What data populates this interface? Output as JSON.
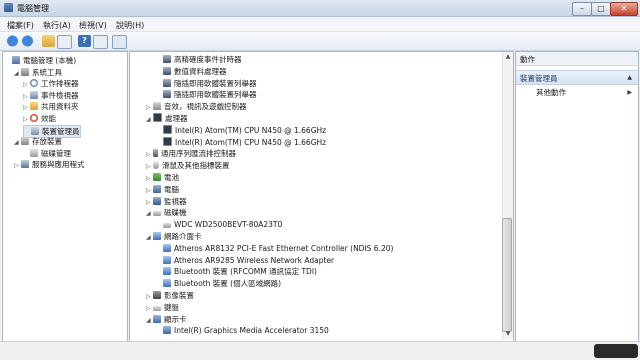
{
  "window": {
    "title": "電腦管理"
  },
  "menu": [
    "檔案(F)",
    "執行(A)",
    "檢視(V)",
    "說明(H)"
  ],
  "left_tree": [
    {
      "label": "電腦管理 (本機)",
      "indent": 0,
      "tri": "",
      "icon": "ico-comp"
    },
    {
      "label": "系統工具",
      "indent": 1,
      "tri": "◢",
      "icon": "ico-tool"
    },
    {
      "label": "工作排程器",
      "indent": 2,
      "tri": "▷",
      "icon": "ico-clock"
    },
    {
      "label": "事件檢視器",
      "indent": 2,
      "tri": "▷",
      "icon": "ico-event"
    },
    {
      "label": "共用資料夾",
      "indent": 2,
      "tri": "▷",
      "icon": "ico-folder"
    },
    {
      "label": "效能",
      "indent": 2,
      "tri": "▷",
      "icon": "ico-perf"
    },
    {
      "label": "裝置管理員",
      "indent": 2,
      "tri": "",
      "icon": "ico-dev",
      "selected": true
    },
    {
      "label": "存放裝置",
      "indent": 1,
      "tri": "◢",
      "icon": "ico-store"
    },
    {
      "label": "磁碟管理",
      "indent": 2,
      "tri": "",
      "icon": "ico-disk"
    },
    {
      "label": "服務與應用程式",
      "indent": 1,
      "tri": "▷",
      "icon": "ico-svc"
    }
  ],
  "device_tree": [
    {
      "label": "高精確度事件計時器",
      "indent": 2,
      "tri": "",
      "icon": "ico-chip"
    },
    {
      "label": "數值資料處理器",
      "indent": 2,
      "tri": "",
      "icon": "ico-chip"
    },
    {
      "label": "隨插即用軟體裝置列舉器",
      "indent": 2,
      "tri": "",
      "icon": "ico-chip"
    },
    {
      "label": "隨插即用軟體裝置列舉器",
      "indent": 2,
      "tri": "",
      "icon": "ico-chip"
    },
    {
      "label": "音效，視訊及遊戲控制器",
      "indent": 1,
      "tri": "▷",
      "icon": "ico-audio"
    },
    {
      "label": "處理器",
      "indent": 1,
      "tri": "◢",
      "icon": "ico-cpu"
    },
    {
      "label": "Intel(R) Atom(TM) CPU N450   @ 1.66GHz",
      "indent": 2,
      "tri": "",
      "icon": "ico-cpu"
    },
    {
      "label": "Intel(R) Atom(TM) CPU N450   @ 1.66GHz",
      "indent": 2,
      "tri": "",
      "icon": "ico-cpu"
    },
    {
      "label": "通用序列匯流排控制器",
      "indent": 1,
      "tri": "▷",
      "icon": "ico-usb"
    },
    {
      "label": "滑鼠及其他指標裝置",
      "indent": 1,
      "tri": "▷",
      "icon": "ico-mouse"
    },
    {
      "label": "電池",
      "indent": 1,
      "tri": "▷",
      "icon": "ico-battery"
    },
    {
      "label": "電腦",
      "indent": 1,
      "tri": "▷",
      "icon": "ico-pc"
    },
    {
      "label": "監視器",
      "indent": 1,
      "tri": "▷",
      "icon": "ico-monitor"
    },
    {
      "label": "磁碟機",
      "indent": 1,
      "tri": "◢",
      "icon": "ico-hdd"
    },
    {
      "label": "WDC WD2500BEVT-80A23T0",
      "indent": 2,
      "tri": "",
      "icon": "ico-hdd"
    },
    {
      "label": "網路介面卡",
      "indent": 1,
      "tri": "◢",
      "icon": "ico-net"
    },
    {
      "label": "Atheros AR8132 PCI-E Fast Ethernet Controller (NDIS 6.20)",
      "indent": 2,
      "tri": "",
      "icon": "ico-net"
    },
    {
      "label": "Atheros AR9285 Wireless Network Adapter",
      "indent": 2,
      "tri": "",
      "icon": "ico-net"
    },
    {
      "label": "Bluetooth 裝置 (RFCOMM 通訊協定 TDI)",
      "indent": 2,
      "tri": "",
      "icon": "ico-net"
    },
    {
      "label": "Bluetooth 裝置 (個人區域網路)",
      "indent": 2,
      "tri": "",
      "icon": "ico-net"
    },
    {
      "label": "影像裝置",
      "indent": 1,
      "tri": "▷",
      "icon": "ico-img"
    },
    {
      "label": "鍵盤",
      "indent": 1,
      "tri": "▷",
      "icon": "ico-kbd"
    },
    {
      "label": "顯示卡",
      "indent": 1,
      "tri": "◢",
      "icon": "ico-display"
    },
    {
      "label": "Intel(R) Graphics Media Accelerator 3150",
      "indent": 2,
      "tri": "",
      "icon": "ico-display"
    }
  ],
  "actions": {
    "title": "動作",
    "section": "裝置管理員",
    "more": "其他動作"
  },
  "toolbar": {
    "help": "?"
  }
}
